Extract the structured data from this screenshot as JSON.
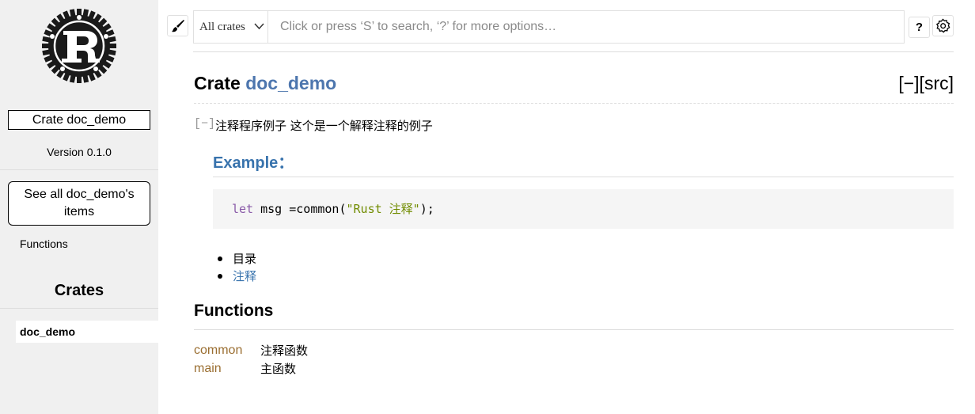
{
  "sidebar": {
    "logo_icon": "rust-gear-logo-icon",
    "crate_box": "Crate doc_demo",
    "version": "Version 0.1.0",
    "see_all": "See all doc_demo's items",
    "functions_link": "Functions",
    "crates_heading": "Crates",
    "crate_items": [
      "doc_demo"
    ]
  },
  "toolbar": {
    "theme_icon": "paintbrush-icon",
    "crate_select": "All crates",
    "search_placeholder": "Click or press ‘S’ to search, ‘?’ for more options…",
    "help_label": "?",
    "settings_icon": "gear-icon"
  },
  "main": {
    "title_prefix": "Crate ",
    "crate_name": "doc_demo",
    "src_links": "[−][src]",
    "collapse_toggle": "[−]",
    "intro": "注释程序例子 这个是一个解释注释的例子",
    "example_heading": "Example：",
    "code": {
      "keyword": "let",
      "middle": " msg =common(",
      "string": "\"Rust 注释\"",
      "end": ");"
    },
    "toc": [
      "目录",
      "注释"
    ],
    "functions_heading": "Functions",
    "functions": [
      {
        "name": "common",
        "desc": "注释函数"
      },
      {
        "name": "main",
        "desc": "主函数"
      }
    ]
  },
  "colors": {
    "crate_name": "#4d76ae",
    "link": "#3873ad",
    "function_name": "#9a6e31",
    "sidebar_bg": "#f0f0f0"
  }
}
